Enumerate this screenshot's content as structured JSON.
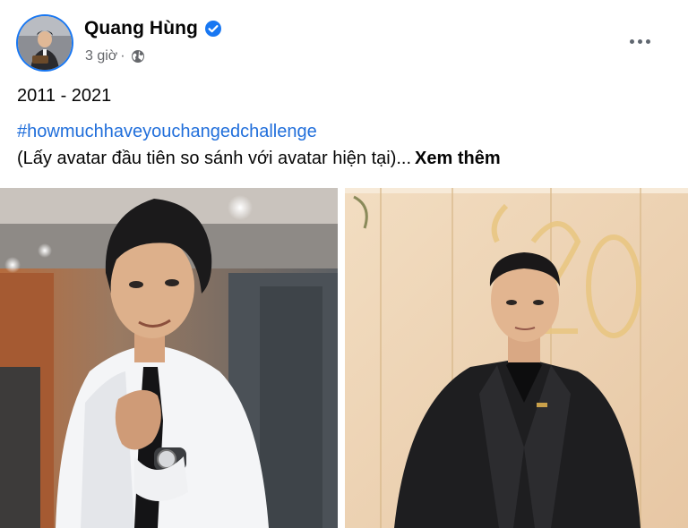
{
  "post": {
    "author": {
      "name": "Quang Hùng",
      "verified": true,
      "verified_icon": "verified-badge-icon",
      "avatar_icon": "profile-photo"
    },
    "meta": {
      "time": "3 giờ",
      "separator": "·",
      "privacy_icon": "globe-icon"
    },
    "more_icon": "more-options-icon",
    "text": {
      "years": "2011 - 2021",
      "hashtag": "#howmuchhaveyouchangedchallenge",
      "caption": "(Lấy avatar đầu tiên so sánh với avatar hiện tại)...",
      "see_more": "Xem thêm"
    },
    "photos": [
      {
        "name": "photo-2011",
        "alt": "young man in white shirt and black tie"
      },
      {
        "name": "photo-2021",
        "alt": "man in black suit at a 20th birthday party"
      }
    ]
  },
  "colors": {
    "text": "#050505",
    "secondary": "#65676b",
    "link": "#216fdb",
    "brand": "#1877f2"
  }
}
